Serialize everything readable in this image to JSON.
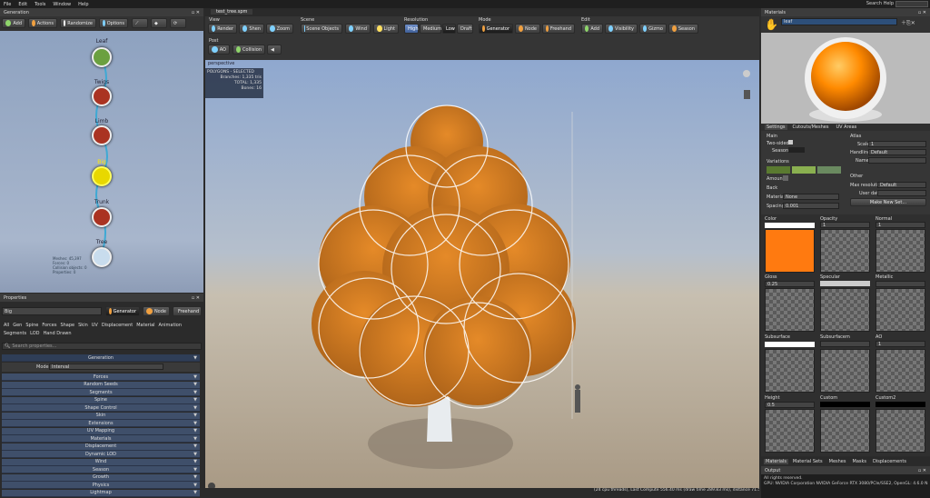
{
  "menu": {
    "items": [
      "File",
      "Edit",
      "Tools",
      "Window",
      "Help"
    ],
    "search_help": "Search Help"
  },
  "generation_panel": {
    "title": "Generation",
    "toolbar": {
      "add": "Add",
      "actions": "Actions",
      "randomize": "Randomize",
      "options": "Options"
    },
    "nodes": {
      "leaf": "Leaf",
      "twigs": "Twigs",
      "limb": "Limb",
      "big": "Big",
      "trunk": "Trunk",
      "tree": "Tree"
    },
    "stats": [
      "Meshes: 45,397",
      "Forces: 0",
      "Collision objects: 0",
      "Properties: 0"
    ]
  },
  "properties_panel": {
    "title": "Properties",
    "name_field": "Big",
    "mode_tabs": {
      "generator": "Generator",
      "node": "Node",
      "freehand": "Freehand"
    },
    "tabs": [
      "All",
      "Gen",
      "Spine",
      "Forces",
      "Shape",
      "Skin",
      "UV",
      "Displacement",
      "Material",
      "Animation",
      "Segments",
      "LOD",
      "Hand Drawn"
    ],
    "search_placeholder": "Search properties...",
    "section_generation": "Generation",
    "mode_label": "Mode",
    "mode_value": "Interval",
    "rows": [
      "Forces",
      "Random Seeds",
      "Segments",
      "Spine",
      "Shape Control",
      "Skin",
      "Extensions",
      "UV Mapping",
      "Materials",
      "Displacement",
      "Dynamic LOD",
      "Wind",
      "Season",
      "Growth",
      "Physics",
      "Lightmap"
    ]
  },
  "document_tab": "test_tree.spm",
  "ribbon": {
    "view": {
      "label": "View",
      "render": "Render",
      "shen": "Shen",
      "zoom": "Zoom"
    },
    "scene": {
      "label": "Scene",
      "scene_objects": "Scene Objects",
      "wind": "Wind",
      "light": "Light"
    },
    "resolution": {
      "label": "Resolution",
      "high": "High",
      "medium": "Medium",
      "low": "Low",
      "draft": "Draft"
    },
    "mode": {
      "label": "Mode",
      "generator": "Generator",
      "node": "Node",
      "freehand": "Freehand"
    },
    "edit": {
      "label": "Edit",
      "add": "Add",
      "visibility": "Visibility",
      "gizmo": "Gizmo",
      "season": "Season"
    },
    "post": {
      "label": "Post",
      "ao": "AO",
      "collision": "Collision"
    }
  },
  "viewport": {
    "label": "perspective",
    "info_title": "POLYGONS - SELECTED",
    "info_branches": "Branches: 1,335 tris",
    "info_total": "TOTAL: 1,335",
    "info_bones": "Bones: 16",
    "status_bar": "(24 cpu threads), Last Compute 556.40 ms (draw time 289.83 ms), distance 71.58"
  },
  "materials_panel": {
    "title": "Materials",
    "material_name": "leaf",
    "tabs": [
      "Settings",
      "Cutouts/Meshes",
      "UV Areas"
    ],
    "main_label": "Main",
    "two_sided": "Two-sided",
    "season_label": "Season",
    "atlas_label": "Atlas",
    "scale_label": "Scale",
    "scale_val": "1",
    "handling_label": "Handling",
    "handling_val": "Default",
    "name_label": "Name",
    "variations_label": "Variations",
    "amount_label": "Amount",
    "other_label": "Other",
    "max_res_label": "Max resolution",
    "max_res_val": "Default",
    "user_data_label": "User data",
    "make_new_set": "Make New Set...",
    "back_label": "Back",
    "material_label": "Material",
    "material_val": "None",
    "spacing_label": "Spacing",
    "spacing_val": "0.001",
    "channels": {
      "color": "Color",
      "opacity": "Opacity",
      "normal": "Normal",
      "gloss": "Gloss",
      "specular": "Specular",
      "metallic": "Metallic",
      "subsurface": "Subsurface",
      "subsurfacem": "Subsurfacem",
      "ao": "AO",
      "height": "Height",
      "custom": "Custom",
      "custom2": "Custom2"
    },
    "gloss_val": "0.25",
    "height_val": "0.5",
    "channel_one": "1",
    "bottom_tabs": [
      "Materials",
      "Material Sets",
      "Meshes",
      "Masks",
      "Displacements"
    ],
    "colors": {
      "swatch_orange": "#ff7a10",
      "var1": "#5a7a30",
      "var2": "#8ab050",
      "var3": "#6a8a60"
    }
  },
  "output_panel": {
    "title": "Output",
    "lines": [
      "All rights reserved.",
      "GPU: NVIDIA Corporation NVIDIA GeForce RTX 3080/PCIe/SSE2, OpenGL: 4.6.0 N"
    ]
  }
}
